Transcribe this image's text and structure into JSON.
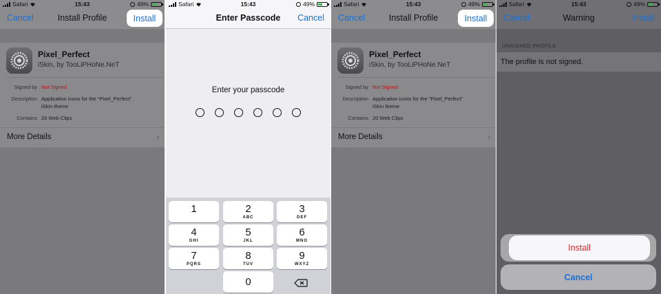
{
  "colors": {
    "accent": "#1a6fd4",
    "danger": "#d2282e",
    "battery": "#3bb54a"
  },
  "status": {
    "carrier": "Safari",
    "time": "15:43",
    "battery": "49%",
    "battery_level": 0.49
  },
  "profile_screen": {
    "nav": {
      "cancel": "Cancel",
      "title": "Install Profile",
      "install": "Install"
    },
    "profile_name": "Pixel_Perfect",
    "profile_sub": "iSkin, by TooLiPHoNe.NeT",
    "signed_by_label": "Signed by",
    "signed_by_value": "Not Signed",
    "description_label": "Description",
    "description_value_1": "Application icons for the \"Pixel_Perfect\"",
    "description_value_2": "iSkin theme",
    "contains_label": "Contains",
    "contains_value": "20 Web Clips",
    "more_details": "More Details",
    "icon": "settings-gear-icon"
  },
  "passcode_screen": {
    "nav": {
      "title": "Enter Passcode",
      "cancel": "Cancel"
    },
    "prompt": "Enter your passcode",
    "dot_count": 6,
    "keys": [
      {
        "n": "1",
        "l": ""
      },
      {
        "n": "2",
        "l": "ABC"
      },
      {
        "n": "3",
        "l": "DEF"
      },
      {
        "n": "4",
        "l": "GHI"
      },
      {
        "n": "5",
        "l": "JKL"
      },
      {
        "n": "6",
        "l": "MNO"
      },
      {
        "n": "7",
        "l": "PQRS"
      },
      {
        "n": "8",
        "l": "TUV"
      },
      {
        "n": "9",
        "l": "WXYZ"
      },
      {
        "n": "0",
        "l": ""
      }
    ],
    "delete_icon": "backspace-icon"
  },
  "warning_screen": {
    "nav": {
      "cancel": "Cancel",
      "title": "Warning",
      "install": "Install"
    },
    "section": "UNSIGNED PROFILE",
    "message": "The profile is not signed.",
    "sheet_install": "Install",
    "sheet_cancel": "Cancel"
  }
}
